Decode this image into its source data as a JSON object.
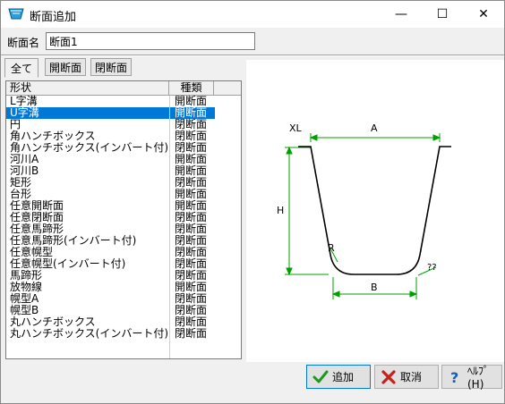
{
  "window": {
    "title": "断面追加",
    "minimize_glyph": "—",
    "maximize_glyph": "☐",
    "close_glyph": "✕"
  },
  "form": {
    "name_label": "断面名",
    "name_value": "断面1"
  },
  "tabs": [
    {
      "label": "全て",
      "active": true
    },
    {
      "label": "開断面",
      "active": false
    },
    {
      "label": "閉断面",
      "active": false
    }
  ],
  "list": {
    "headers": {
      "shape": "形状",
      "type": "種類"
    },
    "rows": [
      {
        "shape": "L字溝",
        "type": "開断面"
      },
      {
        "shape": "U字溝",
        "type": "開断面",
        "selected": true
      },
      {
        "shape": "円",
        "type": "閉断面"
      },
      {
        "shape": "角ハンチボックス",
        "type": "閉断面"
      },
      {
        "shape": "角ハンチボックス(インバート付)",
        "type": "閉断面"
      },
      {
        "shape": "河川A",
        "type": "開断面"
      },
      {
        "shape": "河川B",
        "type": "開断面"
      },
      {
        "shape": "矩形",
        "type": "閉断面"
      },
      {
        "shape": "台形",
        "type": "開断面"
      },
      {
        "shape": "任意開断面",
        "type": "開断面"
      },
      {
        "shape": "任意閉断面",
        "type": "閉断面"
      },
      {
        "shape": "任意馬蹄形",
        "type": "閉断面"
      },
      {
        "shape": "任意馬蹄形(インバート付)",
        "type": "閉断面"
      },
      {
        "shape": "任意幌型",
        "type": "閉断面"
      },
      {
        "shape": "任意幌型(インバート付)",
        "type": "閉断面"
      },
      {
        "shape": "馬蹄形",
        "type": "閉断面"
      },
      {
        "shape": "放物線",
        "type": "開断面"
      },
      {
        "shape": "幌型A",
        "type": "閉断面"
      },
      {
        "shape": "幌型B",
        "type": "閉断面"
      },
      {
        "shape": "丸ハンチボックス",
        "type": "閉断面"
      },
      {
        "shape": "丸ハンチボックス(インバート付)",
        "type": "閉断面"
      }
    ]
  },
  "preview": {
    "labels": {
      "xl": "XL",
      "a": "A",
      "h": "H",
      "r": "R",
      "b": "B",
      "q": "??"
    },
    "line_color": "#00a000"
  },
  "buttons": {
    "add": "追加",
    "cancel": "取消",
    "help": "ﾍﾙﾌﾟ(H)"
  }
}
